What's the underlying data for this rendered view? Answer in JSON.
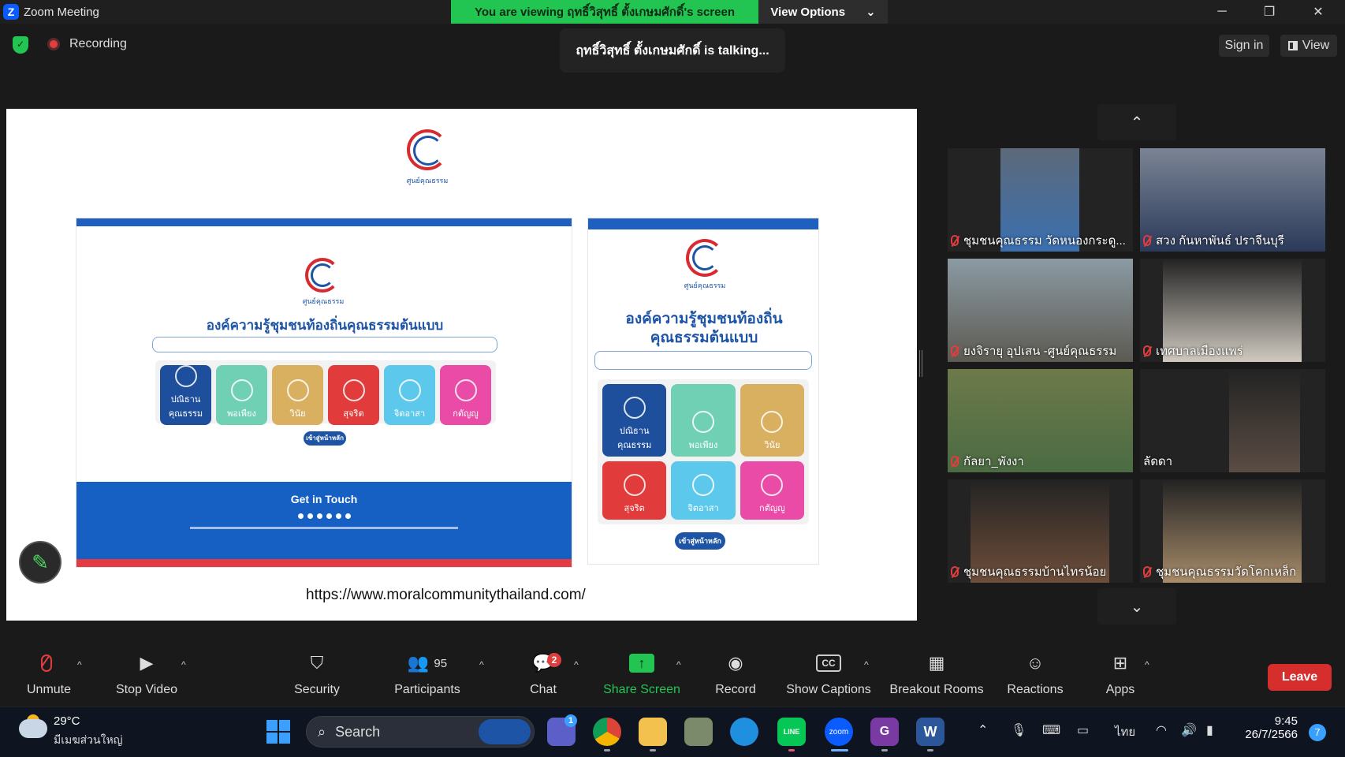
{
  "titlebar": {
    "logo_letter": "Z",
    "title": "Zoom Meeting",
    "viewing": "You are viewing ฤทธิ์วิสุทธิ์ ตั้งเกษมศักดิ์'s screen",
    "view_options": "View Options",
    "controls": [
      "─",
      "❐",
      "✕"
    ]
  },
  "status": {
    "recording": "Recording",
    "talking": "ฤทธิ์วิสุทธิ์ ตั้งเกษมศักดิ์ is talking...",
    "sign_in": "Sign in",
    "view": "View"
  },
  "slide": {
    "url": "https://www.moralcommunitythailand.com/",
    "logo_caption": "ศูนย์คุณธรรม",
    "desktop_title": "องค์ความรู้ชุมชนท้องถิ่นคุณธรรมต้นแบบ",
    "mobile_title_1": "องค์ความรู้ชุมชนท้องถิ่น",
    "mobile_title_2": "คุณธรรมต้นแบบ",
    "button": "เข้าสู่หน้าหลัก",
    "footer_heading": "Get in Touch",
    "tiles": [
      {
        "label": "ปณิธาน คุณธรรม",
        "color": "#1d4f9c"
      },
      {
        "label": "พอเพียง",
        "color": "#6fd0b4"
      },
      {
        "label": "วินัย",
        "color": "#d9b060"
      },
      {
        "label": "สุจริต",
        "color": "#e23b3b"
      },
      {
        "label": "จิตอาสา",
        "color": "#5cc9ec"
      },
      {
        "label": "กตัญญู",
        "color": "#e94ba6"
      }
    ]
  },
  "gallery": {
    "up": "⌃",
    "down": "⌄",
    "participants": [
      {
        "name": "ชุมชนคุณธรรม วัดหนองกระดู...",
        "bg": "#5c6a7a",
        "img": "#3a6fb0"
      },
      {
        "name": "สวง กันหาพันธ์ ปราจีนบุรี",
        "bg": "#7a8494",
        "img": "#2b3a5a"
      },
      {
        "name": "ยงจิรายุ อุปเสน -ศูนย์คุณธรรม",
        "bg": "#8b9aa3",
        "img": "#5d5a52"
      },
      {
        "name": "เทศบาลเมืองแพร่",
        "bg": "#232323",
        "img": "#cfc9bf"
      },
      {
        "name": "กัลยา_พังงา",
        "bg": "#6d7a4a",
        "img": "#4b6b43"
      },
      {
        "name": "ลัดดา",
        "bg": "#232323",
        "img": "#5a4d44"
      },
      {
        "name": "ชุมชนคุณธรรมบ้านไทรน้อย",
        "bg": "#232323",
        "img": "#6e4e3a"
      },
      {
        "name": "ชุมชนคุณธรรมวัดโคกเหล็ก",
        "bg": "#232323",
        "img": "#a88c6a"
      }
    ]
  },
  "toolbar": {
    "unmute": "Unmute",
    "stop_video": "Stop Video",
    "security": "Security",
    "participants": "Participants",
    "participants_count": "95",
    "chat": "Chat",
    "chat_badge": "2",
    "share": "Share Screen",
    "record": "Record",
    "captions": "Show Captions",
    "captions_icon": "CC",
    "breakout": "Breakout Rooms",
    "reactions": "Reactions",
    "apps": "Apps",
    "leave": "Leave"
  },
  "taskbar": {
    "temp": "29°C",
    "location": "มีเมฆส่วนใหญ่",
    "search": "Search",
    "teams_badge": "1",
    "lang": "ไทย",
    "time": "9:45",
    "date": "26/7/2566",
    "notif": "7",
    "zoom_label": "zoom",
    "line_label": "LINE",
    "word_label": "W",
    "pdf_label": "G",
    "tray_up": "⌃"
  }
}
